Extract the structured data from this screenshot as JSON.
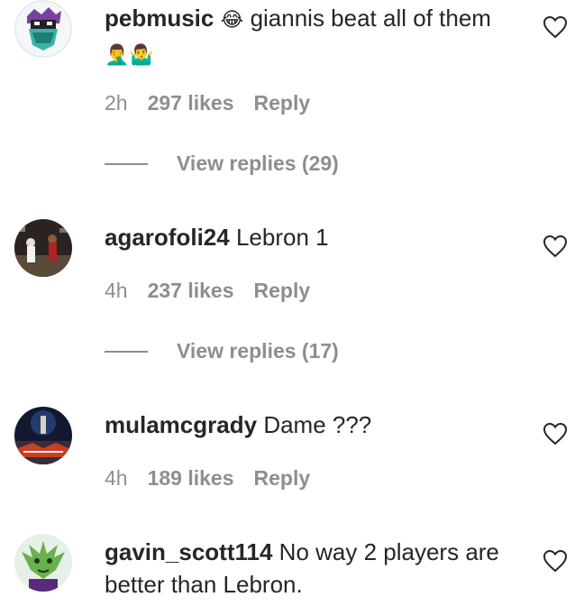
{
  "comments": [
    {
      "username": "pebmusic",
      "emoji_lead": "😂",
      "text": "giannis beat all of them",
      "emoji_tail": "🤦‍♂️🤷‍♂️",
      "time": "2h",
      "likes": "297 likes",
      "reply": "Reply",
      "view_replies": "View replies (29)"
    },
    {
      "username": "agarofoli24",
      "text": "Lebron 1",
      "time": "4h",
      "likes": "237 likes",
      "reply": "Reply",
      "view_replies": "View replies (17)"
    },
    {
      "username": "mulamcgrady",
      "text": "Dame ???",
      "time": "4h",
      "likes": "189 likes",
      "reply": "Reply"
    },
    {
      "username": "gavin_scott114",
      "text": "No way 2 players are better than Lebron."
    }
  ]
}
